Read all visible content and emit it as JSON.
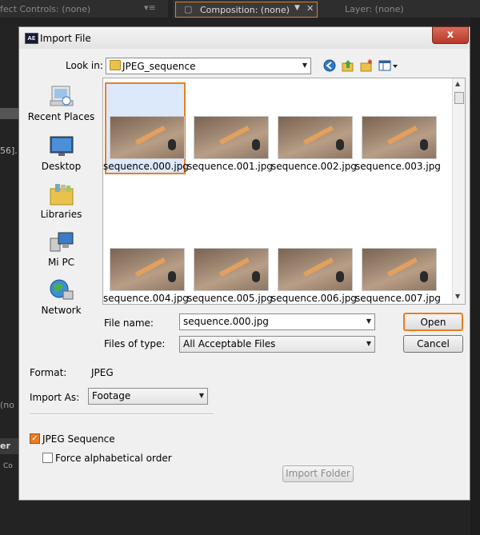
{
  "background": {
    "effect_controls": "fect Controls: (none)",
    "composition_tab": "Composition: (none)",
    "layer_tab": "Layer: (none)",
    "left_text_1": "56].",
    "left_text_2": "(no",
    "left_text_3": "er",
    "left_text_4": "Co"
  },
  "dialog": {
    "title": "Import File",
    "app_badge": "AE",
    "close_symbol": "x"
  },
  "lookin": {
    "label": "Look in:",
    "value": "JPEG_sequence"
  },
  "places": [
    {
      "label": "Recent Places",
      "icon": "recent-places-icon"
    },
    {
      "label": "Desktop",
      "icon": "desktop-icon"
    },
    {
      "label": "Libraries",
      "icon": "libraries-icon"
    },
    {
      "label": "Mi PC",
      "icon": "computer-icon"
    },
    {
      "label": "Network",
      "icon": "network-icon"
    }
  ],
  "files": [
    "sequence.000.jpg",
    "sequence.001.jpg",
    "sequence.002.jpg",
    "sequence.003.jpg",
    "sequence.004.jpg",
    "sequence.005.jpg",
    "sequence.006.jpg",
    "sequence.007.jpg"
  ],
  "selected_file": "sequence.000.jpg",
  "filename": {
    "label": "File name:",
    "value": "sequence.000.jpg"
  },
  "filetype": {
    "label": "Files of type:",
    "value": "All Acceptable Files"
  },
  "buttons": {
    "open": "Open",
    "cancel": "Cancel",
    "import_folder": "Import Folder"
  },
  "format": {
    "label": "Format:",
    "value": "JPEG"
  },
  "import_as": {
    "label": "Import As:",
    "value": "Footage"
  },
  "options": {
    "jpeg_sequence": "JPEG Sequence",
    "jpeg_sequence_checked": true,
    "force_alpha": "Force alphabetical order",
    "force_alpha_checked": false
  },
  "accent_color": "#e87e24"
}
